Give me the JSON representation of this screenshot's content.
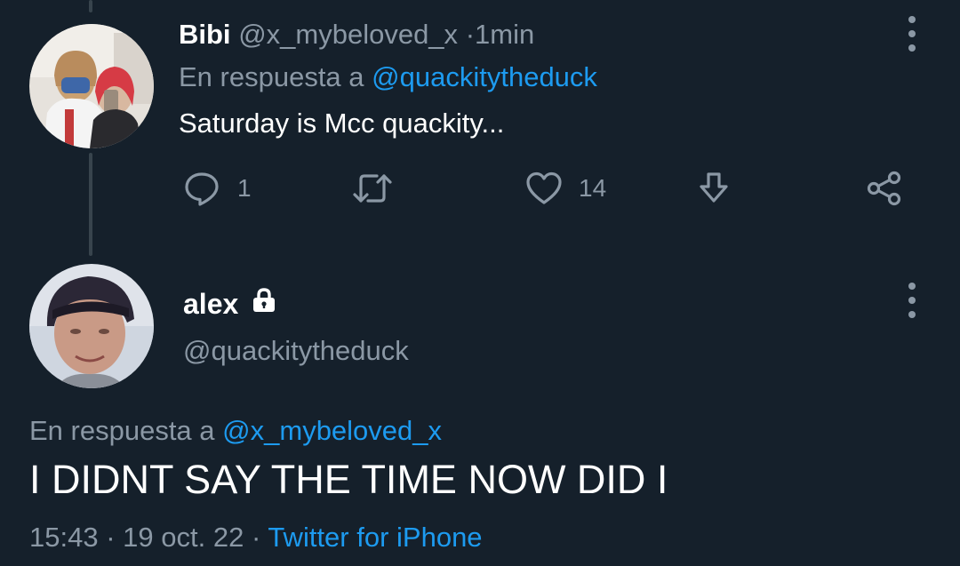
{
  "reply_tweet": {
    "name": "Bibi",
    "handle": "@x_mybeloved_x",
    "separator": "·",
    "time": "1min",
    "replying_prefix": "En respuesta a",
    "replying_mention": "@quackitytheduck",
    "text": "Saturday is Mcc quackity...",
    "actions": {
      "reply_count": "1",
      "like_count": "14"
    }
  },
  "main_tweet": {
    "name": "alex",
    "handle": "@quackitytheduck",
    "replying_prefix": "En respuesta a",
    "replying_mention": "@x_mybeloved_x",
    "text": "I DIDNT SAY THE TIME NOW DID I",
    "time": "15:43",
    "separator": "·",
    "date": "19 oct. 22",
    "source": "Twitter for iPhone"
  },
  "colors": {
    "background": "#15202b",
    "secondary_text": "#8b98a5",
    "accent": "#1d9bf0",
    "thread_line": "#38444d"
  }
}
